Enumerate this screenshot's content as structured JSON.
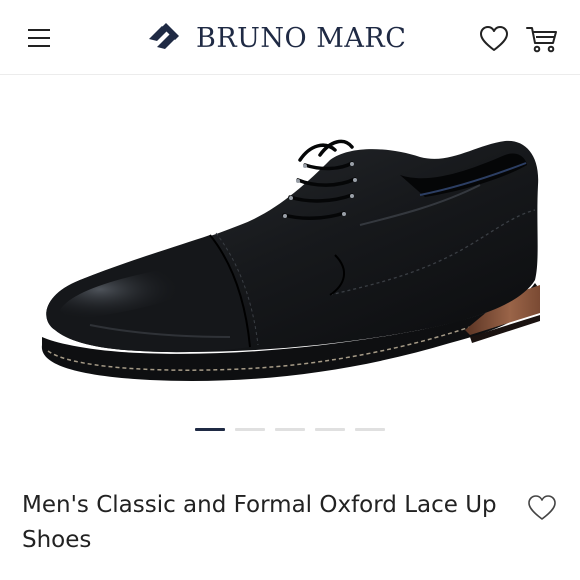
{
  "header": {
    "brand_name": "BRUNO MARC",
    "icons": {
      "menu": "hamburger-menu-icon",
      "brand_mark": "bruno-marc-logo-mark",
      "wishlist": "heart-outline-icon",
      "cart": "shopping-cart-icon"
    },
    "brand_color": "#1f2a44"
  },
  "gallery": {
    "image_subject": "black cap-toe oxford lace-up dress shoe",
    "slide_count": 5,
    "active_slide": 1,
    "indicator_active_color": "#1f2a44",
    "indicator_inactive_color": "#e0e0e0"
  },
  "product": {
    "title": "Men's Classic and Formal Oxford Lace Up Shoes",
    "favorite_icon": "heart-outline-icon"
  }
}
